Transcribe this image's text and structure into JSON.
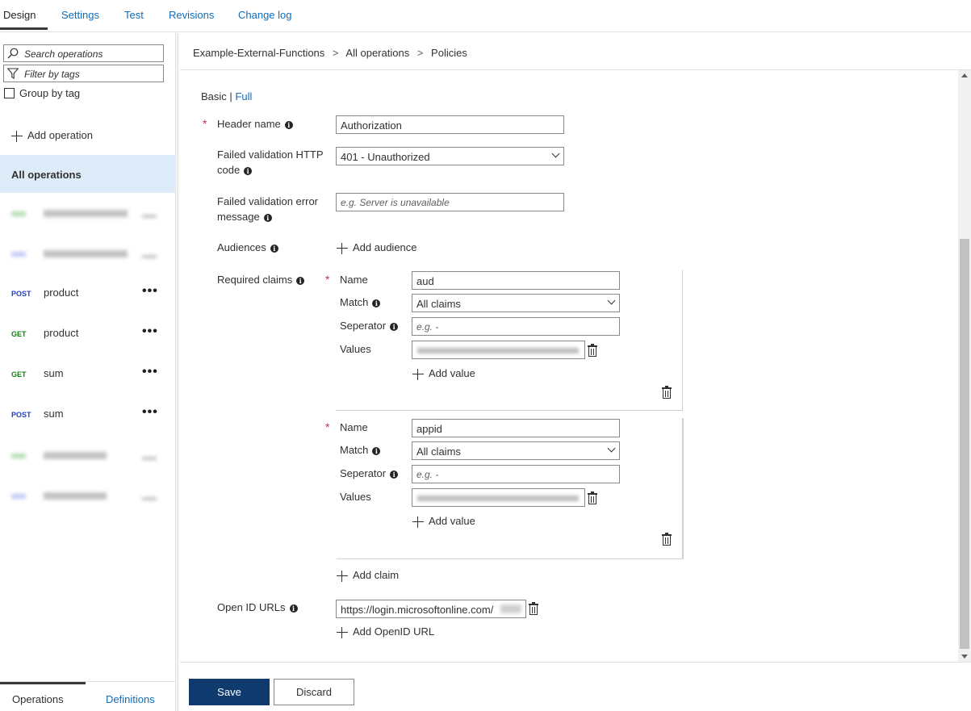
{
  "top_tabs": [
    "Design",
    "Settings",
    "Test",
    "Revisions",
    "Change log"
  ],
  "left": {
    "search_placeholder": "Search operations",
    "filter_placeholder": "Filter by tags",
    "group_by_tag": "Group by tag",
    "add_operation": "Add operation",
    "all_operations": "All operations",
    "operations": [
      {
        "verb": "POST",
        "name": "product"
      },
      {
        "verb": "GET",
        "name": "product"
      },
      {
        "verb": "GET",
        "name": "sum"
      },
      {
        "verb": "POST",
        "name": "sum"
      }
    ],
    "more_glyph": "•••",
    "bottom_tabs": [
      "Operations",
      "Definitions"
    ]
  },
  "breadcrumb": [
    "Example-External-Functions",
    "All operations",
    "Policies"
  ],
  "breadcrumb_sep": ">",
  "mode": {
    "basic": "Basic",
    "sep": "|",
    "full": "Full"
  },
  "form": {
    "header_name_label": "Header name",
    "header_name_value": "Authorization",
    "failed_code_label_1": "Failed validation HTTP",
    "failed_code_label_2": "code",
    "failed_code_value": "401 - Unauthorized",
    "failed_msg_label_1": "Failed validation error",
    "failed_msg_label_2": "message",
    "failed_msg_placeholder": "e.g. Server is unavailable",
    "audiences_label": "Audiences",
    "add_audience": "Add audience",
    "required_claims_label": "Required claims",
    "claims": [
      {
        "name_label": "Name",
        "name_value": "aud",
        "match_label": "Match",
        "match_value": "All claims",
        "separator_label": "Seperator",
        "separator_placeholder": "e.g. -",
        "values_label": "Values",
        "add_value": "Add value"
      },
      {
        "name_label": "Name",
        "name_value": "appid",
        "match_label": "Match",
        "match_value": "All claims",
        "separator_label": "Seperator",
        "separator_placeholder": "e.g. -",
        "values_label": "Values",
        "add_value": "Add value"
      }
    ],
    "add_claim": "Add claim",
    "openid_label": "Open ID URLs",
    "openid_value": "https://login.microsoftonline.com/",
    "add_openid": "Add OpenID URL",
    "required_mark": "*",
    "info_glyph": "i"
  },
  "buttons": {
    "save": "Save",
    "discard": "Discard"
  }
}
